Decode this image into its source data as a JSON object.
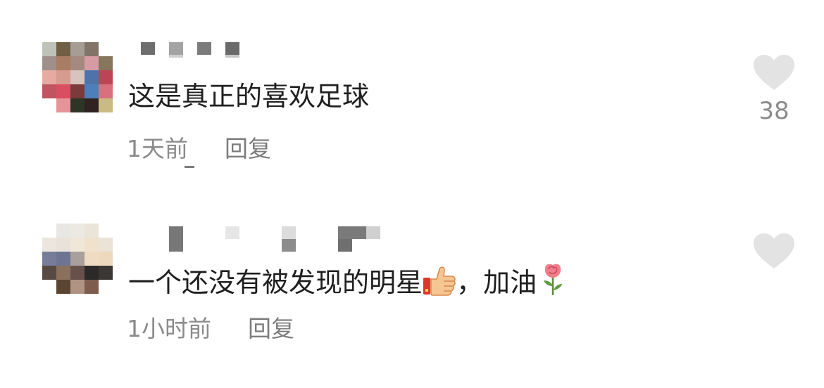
{
  "comments": [
    {
      "text": "这是真正的喜欢足球",
      "time": "1天前",
      "reply_label": "回复",
      "likes": "38",
      "avatar_icon": "pixelated-avatar",
      "username_icon": "blurred-username"
    },
    {
      "text_before": "一个还没有被发现的明星",
      "text_middle": "，加油",
      "emoji_1": "thumbs-up-icon",
      "emoji_2": "rose-icon",
      "time": "1小时前",
      "reply_label": "回复",
      "avatar_icon": "pixelated-avatar",
      "username_icon": "blurred-username"
    }
  ],
  "colors": {
    "text": "#1f1f1f",
    "meta": "#8b8b8b",
    "heart": "#e3e3e3"
  }
}
